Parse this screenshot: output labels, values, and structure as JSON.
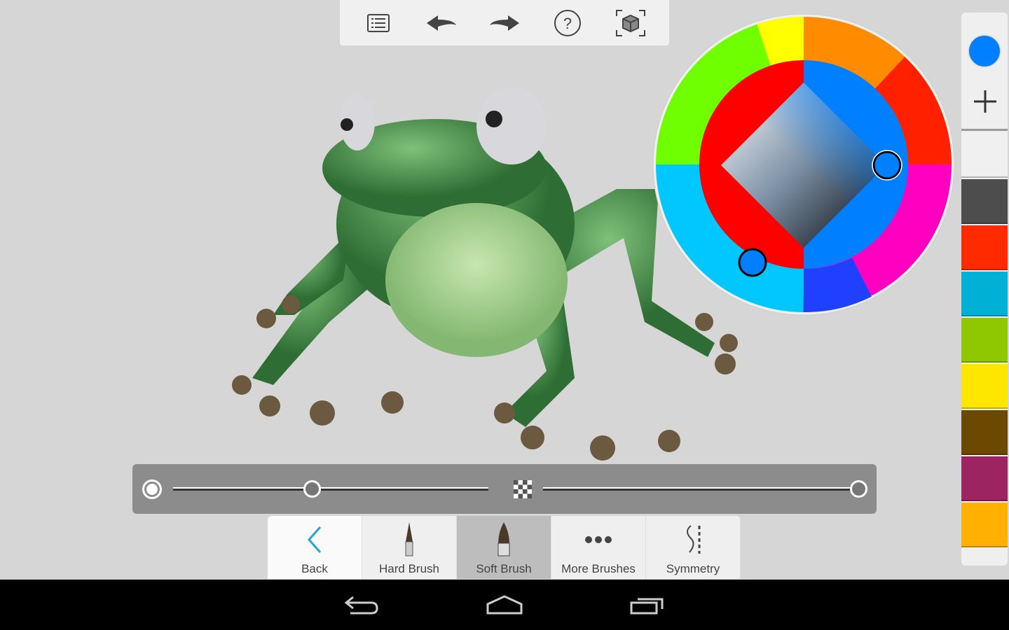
{
  "toolbar": {
    "icons": [
      "layers-list-icon",
      "undo-icon",
      "redo-icon",
      "help-icon",
      "3d-view-icon"
    ]
  },
  "color_picker": {
    "current_color": "#0080ff",
    "hue": "blue"
  },
  "palette": {
    "current": "#0080ff",
    "swatches": [
      "#f0f0f0",
      "#4d4d4d",
      "#ff2a00",
      "#00b0d6",
      "#8fc800",
      "#ffe600",
      "#6b4a00",
      "#9c2460",
      "#ffb000"
    ]
  },
  "sliders": {
    "size_level": 0.44,
    "opacity_level": 1.0
  },
  "bottom": {
    "buttons": [
      {
        "label": "Back",
        "icon": "back-chevron-icon"
      },
      {
        "label": "Hard Brush",
        "icon": "hard-brush-icon"
      },
      {
        "label": "Soft Brush",
        "icon": "soft-brush-icon",
        "selected": true
      },
      {
        "label": "More Brushes",
        "icon": "more-dots-icon"
      },
      {
        "label": "Symmetry",
        "icon": "symmetry-icon"
      }
    ]
  }
}
